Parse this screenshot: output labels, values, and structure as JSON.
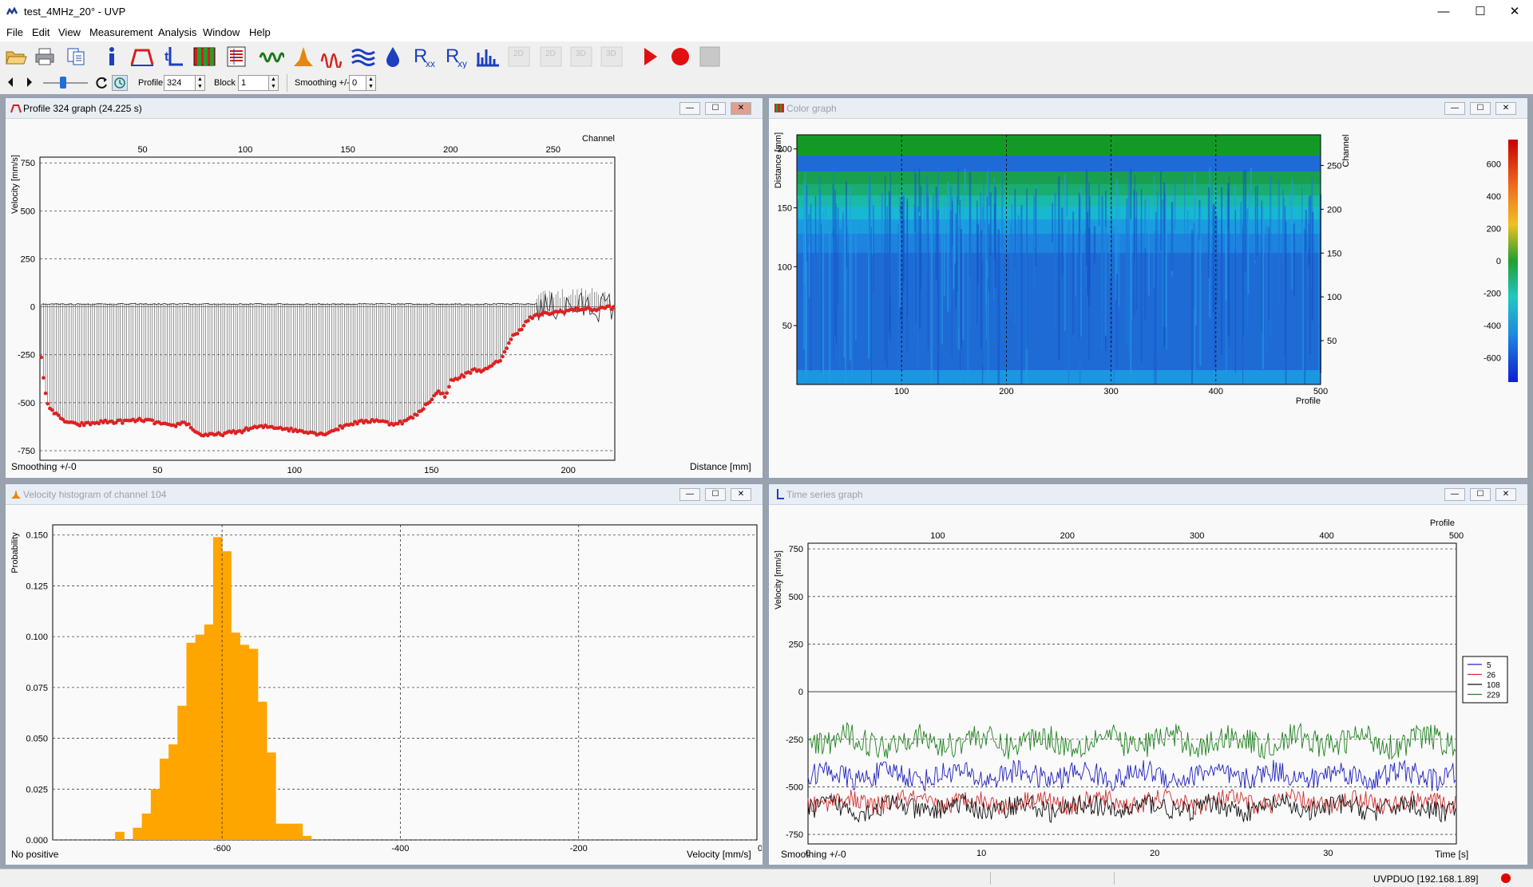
{
  "app": {
    "title": "test_4MHz_20° - UVP",
    "menu": [
      "File",
      "Edit",
      "View",
      "Measurement",
      "Analysis",
      "Window",
      "Help"
    ]
  },
  "toolbar": {
    "icons": [
      "open-icon",
      "print-icon",
      "copy-icon",
      "info-icon",
      "profile-icon",
      "time-series-icon",
      "color-graph-icon",
      "table-icon",
      "signal-icon",
      "histogram-icon",
      "frequency-icon",
      "waves-icon",
      "drop-icon",
      "rxx-icon",
      "rxy-icon",
      "spectrum-icon",
      "2d-icon",
      "2d-alt-icon",
      "3d-icon",
      "3d-alt-icon",
      "play-icon",
      "record-icon",
      "stop-icon"
    ],
    "rxx_label": "R",
    "rxx_sub": "xx",
    "rxy_label": "R",
    "rxy_sub": "xy",
    "disabled_labels": [
      "2D",
      "2D",
      "3D",
      "3D"
    ]
  },
  "navbar": {
    "profile_label": "Profile",
    "profile_value": "324",
    "block_label": "Block",
    "block_value": "1",
    "smoothing_label": "Smoothing +/-",
    "smoothing_value": "0"
  },
  "windows": {
    "profile": {
      "title": "Profile 324 graph (24.225 s)",
      "footer_left": "Smoothing +/-0",
      "footer_right": "Distance [mm]",
      "top_axis_label": "Channel",
      "y_label": "Velocity [mm/s]"
    },
    "color": {
      "title": "Color graph",
      "y_label": "Distance [mm]",
      "x_label": "Profile",
      "right_label": "Channel"
    },
    "histogram": {
      "title": "Velocity histogram of channel 104",
      "footer_left": "No positive",
      "x_label": "Velocity [mm/s]",
      "y_label": "Probability"
    },
    "timeseries": {
      "title": "Time series graph",
      "footer_left": "Smoothing +/-0",
      "x_label": "Time [s]",
      "top_axis_label": "Profile",
      "y_label": "Velocity [mm/s]"
    }
  },
  "statusbar": {
    "connection": "UVPDUO [192.168.1.89]",
    "record_color": "#e00000"
  },
  "chart_data": [
    {
      "id": "profile",
      "type": "scatter",
      "title": "Profile 324 graph (24.225 s)",
      "xlabel": "Distance [mm]",
      "ylabel": "Velocity [mm/s]",
      "top_axis": {
        "label": "Channel",
        "ticks": [
          50,
          100,
          150,
          200,
          250
        ]
      },
      "x_ticks": [
        50,
        100,
        150,
        200
      ],
      "y_ticks": [
        750,
        500,
        250,
        0,
        -250,
        -500,
        -750
      ],
      "xlim": [
        7,
        217
      ],
      "ylim": [
        -800,
        780
      ],
      "grid": "horizontal dashed",
      "series": [
        {
          "color": "#e02020",
          "x": [
            7,
            8,
            9,
            10,
            12,
            15,
            20,
            25,
            30,
            35,
            40,
            45,
            50,
            55,
            60,
            65,
            70,
            75,
            80,
            85,
            90,
            95,
            100,
            105,
            110,
            115,
            120,
            125,
            130,
            135,
            140,
            145,
            150,
            153,
            155,
            157,
            160,
            163,
            165,
            170,
            175,
            180,
            183,
            186,
            190,
            195,
            200,
            205,
            210,
            215,
            217
          ],
          "y": [
            -170,
            -350,
            -450,
            -510,
            -550,
            -590,
            -615,
            -610,
            -600,
            -600,
            -595,
            -590,
            -605,
            -625,
            -600,
            -665,
            -670,
            -660,
            -650,
            -630,
            -625,
            -630,
            -645,
            -650,
            -665,
            -640,
            -610,
            -600,
            -590,
            -610,
            -600,
            -560,
            -480,
            -440,
            -470,
            -390,
            -370,
            -350,
            -330,
            -330,
            -280,
            -150,
            -110,
            -60,
            -40,
            -30,
            -20,
            -10,
            -15,
            0,
            -10
          ]
        }
      ]
    },
    {
      "id": "color",
      "type": "heatmap",
      "title": "Color graph",
      "xlabel": "Profile",
      "ylabel": "Distance [mm]",
      "x_ticks": [
        100,
        200,
        300,
        400,
        500
      ],
      "y_ticks": [
        50,
        100,
        150,
        200
      ],
      "right_axis": {
        "label": "Channel",
        "ticks": [
          50,
          100,
          150,
          200,
          250
        ]
      },
      "xlim": [
        0,
        500
      ],
      "ylim": [
        0,
        212
      ],
      "colorbar_ticks": [
        600,
        400,
        200,
        0,
        -200,
        -400,
        -600
      ],
      "color_range": [
        -750,
        750
      ]
    },
    {
      "id": "histogram",
      "type": "bar",
      "title": "Velocity histogram of channel 104",
      "xlabel": "Velocity [mm/s]",
      "ylabel": "Probability",
      "x_ticks": [
        -600,
        -400,
        -200,
        0
      ],
      "y_ticks": [
        0.0,
        0.025,
        0.05,
        0.075,
        0.1,
        0.125,
        0.15
      ],
      "xlim": [
        -790,
        0
      ],
      "ylim": [
        0,
        0.155
      ],
      "bin_width": 10,
      "bin_starts": [
        -720,
        -710,
        -700,
        -690,
        -680,
        -670,
        -660,
        -650,
        -640,
        -630,
        -620,
        -610,
        -600,
        -590,
        -580,
        -570,
        -560,
        -550,
        -540,
        -530,
        -520,
        -510
      ],
      "values": [
        0.004,
        0.0,
        0.006,
        0.013,
        0.025,
        0.04,
        0.047,
        0.066,
        0.097,
        0.101,
        0.106,
        0.149,
        0.142,
        0.102,
        0.096,
        0.094,
        0.068,
        0.043,
        0.008,
        0.008,
        0.008,
        0.002
      ],
      "color": "#ffa500"
    },
    {
      "id": "timeseries",
      "type": "line",
      "title": "Time series graph",
      "xlabel": "Time [s]",
      "ylabel": "Velocity [mm/s]",
      "x_ticks": [
        0,
        10,
        20,
        30
      ],
      "y_ticks": [
        750,
        500,
        250,
        0,
        -250,
        -500,
        -750
      ],
      "top_axis": {
        "label": "Profile",
        "ticks": [
          100,
          200,
          300,
          400,
          500
        ]
      },
      "xlim": [
        0,
        37.4
      ],
      "ylim": [
        -800,
        780
      ],
      "legend": "right",
      "series": [
        {
          "name": "5",
          "color": "#2020c0",
          "mean": -440,
          "amplitude": 60
        },
        {
          "name": "26",
          "color": "#d03030",
          "mean": -580,
          "amplitude": 50
        },
        {
          "name": "108",
          "color": "#111111",
          "mean": -610,
          "amplitude": 55
        },
        {
          "name": "229",
          "color": "#208020",
          "mean": -260,
          "amplitude": 70
        }
      ]
    }
  ]
}
